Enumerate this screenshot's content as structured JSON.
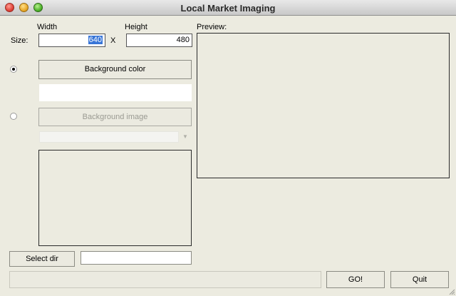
{
  "window": {
    "title": "Local Market Imaging"
  },
  "size": {
    "label": "Size:",
    "width_label": "Width",
    "height_label": "Height",
    "width_value": "640",
    "height_value": "480",
    "separator": "X"
  },
  "background": {
    "color_button": "Background color",
    "image_button": "Background image",
    "color_selected": true
  },
  "preview": {
    "label": "Preview:"
  },
  "directory": {
    "select_button": "Select dir",
    "path_value": ""
  },
  "actions": {
    "go_button": "GO!",
    "quit_button": "Quit"
  },
  "status": {
    "text": ""
  },
  "icons": {
    "close": "close-icon",
    "minimize": "minimize-icon",
    "maximize": "maximize-icon",
    "dropdown": "chevron-down-icon",
    "resize": "resize-grip-icon"
  }
}
